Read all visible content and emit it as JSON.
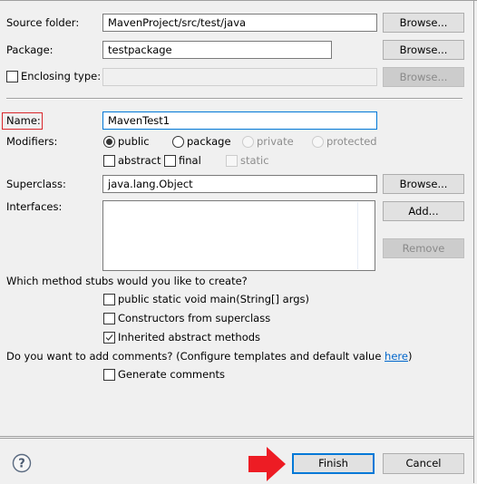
{
  "form": {
    "source_folder": {
      "label": "Source folder:",
      "value": "MavenProject/src/test/java",
      "browse_label": "Browse..."
    },
    "package": {
      "label": "Package:",
      "value": "testpackage",
      "browse_label": "Browse..."
    },
    "enclosing_type": {
      "label": "Enclosing type:",
      "checked": false,
      "value": "",
      "browse_label": "Browse..."
    },
    "name": {
      "label": "Name:",
      "value": "MavenTest1"
    },
    "modifiers": {
      "label": "Modifiers:",
      "access": [
        {
          "label": "public",
          "selected": true,
          "enabled": true
        },
        {
          "label": "package",
          "selected": false,
          "enabled": true
        },
        {
          "label": "private",
          "selected": false,
          "enabled": false
        },
        {
          "label": "protected",
          "selected": false,
          "enabled": false
        }
      ],
      "flags": [
        {
          "label": "abstract",
          "checked": false,
          "enabled": true
        },
        {
          "label": "final",
          "checked": false,
          "enabled": true
        },
        {
          "label": "static",
          "checked": false,
          "enabled": false
        }
      ]
    },
    "superclass": {
      "label": "Superclass:",
      "value": "java.lang.Object",
      "browse_label": "Browse..."
    },
    "interfaces": {
      "label": "Interfaces:",
      "items": [],
      "add_label": "Add...",
      "remove_label": "Remove"
    },
    "method_stubs": {
      "question": "Which method stubs would you like to create?",
      "options": [
        {
          "label": "public static void main(String[] args)",
          "checked": false
        },
        {
          "label": "Constructors from superclass",
          "checked": false
        },
        {
          "label": "Inherited abstract methods",
          "checked": true
        }
      ]
    },
    "comments": {
      "question_prefix": "Do you want to add comments? (Configure templates and default value ",
      "link_text": "here",
      "question_suffix": ")",
      "option": {
        "label": "Generate comments",
        "checked": false
      }
    }
  },
  "footer": {
    "help_icon": "?",
    "finish_label": "Finish",
    "cancel_label": "Cancel"
  },
  "annotations": {
    "highlight_color": "#d9262b",
    "arrow_color": "#ed1c24"
  }
}
